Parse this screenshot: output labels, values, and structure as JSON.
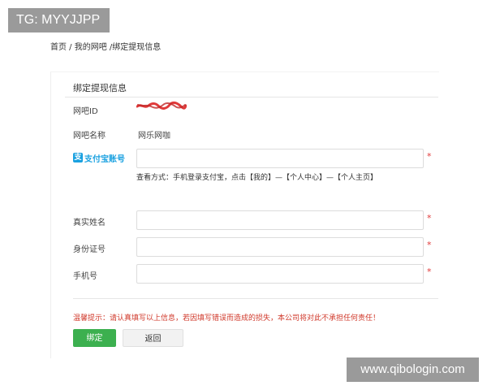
{
  "watermarks": {
    "top_left": "TG: MYYJJPP",
    "bottom_right": "www.qibologin.com"
  },
  "breadcrumb": "首页 / 我的网吧 /绑定提现信息",
  "form": {
    "title": "绑定提现信息",
    "netbar_id": {
      "label": "网吧ID",
      "value": "(redacted)"
    },
    "netbar_name": {
      "label": "网吧名称",
      "value": "网乐网咖"
    },
    "alipay": {
      "icon": "alipay-icon",
      "badge_text": "支",
      "label": "支付宝账号",
      "value": "",
      "required_mark": "*",
      "hint": "查看方式：手机登录支付宝，点击【我的】—【个人中心】—【个人主页】"
    },
    "real_name": {
      "label": "真实姓名",
      "value": "",
      "required_mark": "*"
    },
    "id_number": {
      "label": "身份证号",
      "value": "",
      "required_mark": "*"
    },
    "phone": {
      "label": "手机号",
      "value": "",
      "required_mark": "*"
    },
    "warning": "温馨提示：请认真填写以上信息，若因填写错误而造成的损失，本公司将对此不承担任何责任！",
    "buttons": {
      "bind": "绑定",
      "back": "返回"
    }
  },
  "colors": {
    "primary_button": "#3cb04f",
    "warning_text": "#d0392b",
    "alipay_blue": "#1aa1e0",
    "required_star": "#e03a3a"
  }
}
